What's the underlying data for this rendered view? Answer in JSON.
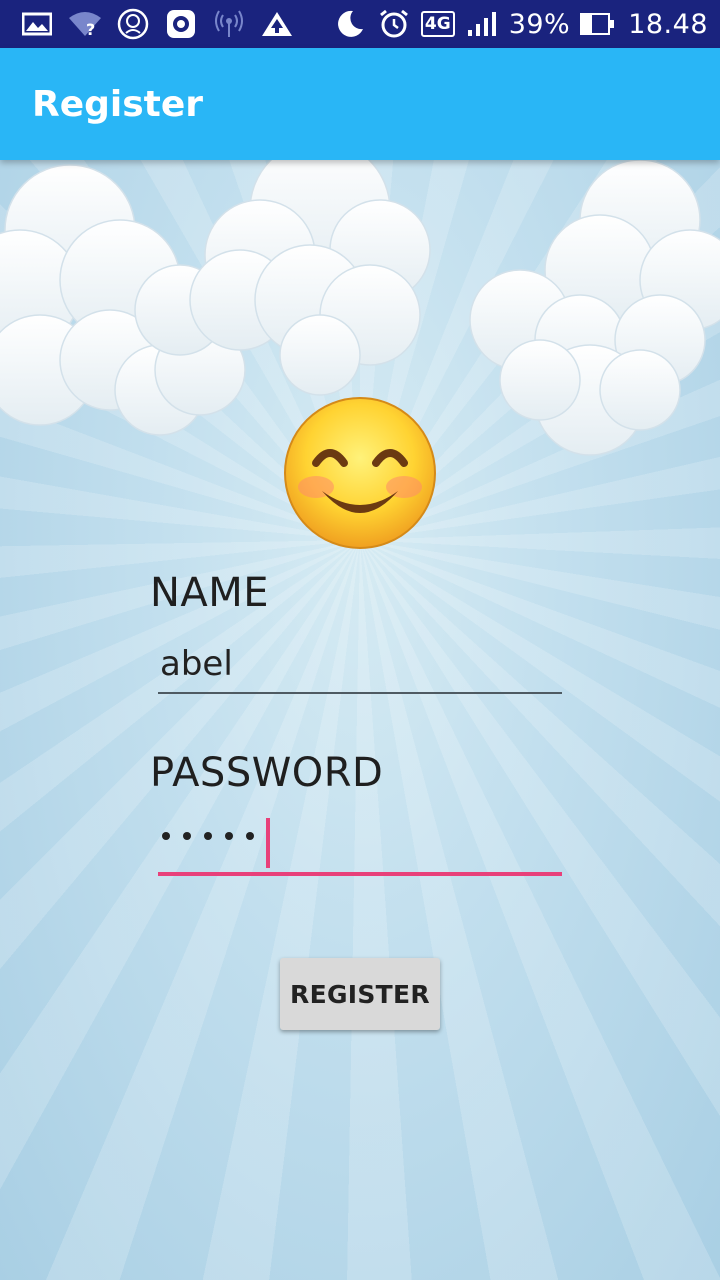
{
  "status_bar": {
    "icons": [
      "gallery-icon",
      "wifi-unknown-icon",
      "rp-icon",
      "camera-app-icon",
      "hotspot-icon",
      "upload-icon",
      "moon-icon",
      "alarm-icon"
    ],
    "network": "4G",
    "battery": "39%",
    "battery_level": 0.39,
    "time": "18.48"
  },
  "app_bar": {
    "title": "Register"
  },
  "form": {
    "name_label": "NAME",
    "name_value": "abel",
    "password_label": "PASSWORD",
    "password_length": 5,
    "register_label": "REGISTER"
  },
  "colors": {
    "status_bar": "#1a237e",
    "app_bar": "#29b6f6",
    "accent": "#e8407a",
    "button": "#d9d9d9"
  }
}
